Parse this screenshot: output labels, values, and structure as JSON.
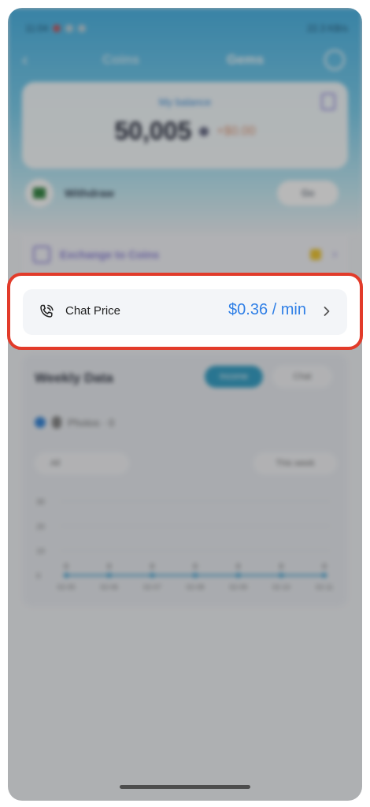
{
  "status_bar": {
    "time": "11:04",
    "right": "22.3 KB/s"
  },
  "nav": {
    "tab_1": "Coins",
    "tab_2": "Gems"
  },
  "balance": {
    "label": "My balance",
    "amount": "50,005",
    "change": "+$0.00"
  },
  "withdraw": {
    "label": "Withdraw",
    "button": "Go"
  },
  "exchange": {
    "label": "Exchange to Coins"
  },
  "chat_price": {
    "label": "Chat Price",
    "value": "$0.36 / min"
  },
  "weekly": {
    "title": "Weekly Data",
    "segment_active": "Income",
    "segment_inactive": "Chat",
    "legend": "Photos · 0",
    "filter_left": "All",
    "filter_right": "This week",
    "y_ticks": [
      "30",
      "20",
      "10",
      "0"
    ],
    "x_ticks": [
      "02-05",
      "02-06",
      "02-07",
      "02-08",
      "02-09",
      "02-10",
      "02-11"
    ]
  },
  "chart_data": {
    "type": "line",
    "categories": [
      "02-05",
      "02-06",
      "02-07",
      "02-08",
      "02-09",
      "02-10",
      "02-11"
    ],
    "values": [
      0,
      0,
      0,
      0,
      0,
      0,
      0
    ],
    "ylim": [
      0,
      30
    ]
  },
  "colors": {
    "highlight": "#e23b2a",
    "price": "#2f7fe6",
    "header": "#4fb6e6"
  }
}
